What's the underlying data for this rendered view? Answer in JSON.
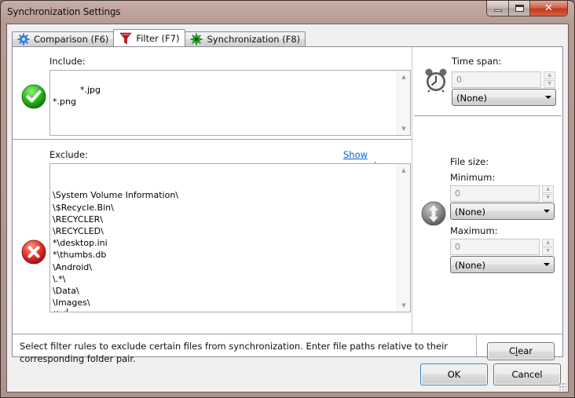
{
  "window": {
    "title": "Synchronization Settings",
    "controls": {
      "minimize": "minimize",
      "maximize": "maximize",
      "close": "close"
    }
  },
  "tabs": [
    {
      "label": "Comparison (F6)",
      "icon": "gear-blue-icon",
      "active": false
    },
    {
      "label": "Filter (F7)",
      "icon": "funnel-icon",
      "active": true
    },
    {
      "label": "Synchronization (F8)",
      "icon": "gear-green-icon",
      "active": false
    }
  ],
  "filter": {
    "include": {
      "label": "Include:",
      "icon": "checkmark-icon",
      "value": "*.jpg\n*.png"
    },
    "exclude": {
      "label": "Exclude:",
      "icon": "cross-icon",
      "show_examples_link": "Show examples",
      "lines": [
        "\\System Volume Information\\",
        "\\$Recycle.Bin\\",
        "\\RECYCLER\\",
        "\\RECYCLED\\",
        "*\\desktop.ini",
        "*\\thumbs.db",
        "\\Android\\",
        "\\.*\\",
        "\\Data\\",
        "\\Images\\",
        "*\\.*"
      ]
    },
    "time_span": {
      "label": "Time span:",
      "icon": "alarm-clock-icon",
      "value": "0",
      "unit_selected": "(None)"
    },
    "file_size": {
      "label": "File size:",
      "icon": "size-arrows-icon",
      "minimum": {
        "label": "Minimum:",
        "value": "0",
        "unit_selected": "(None)"
      },
      "maximum": {
        "label": "Maximum:",
        "value": "0",
        "unit_selected": "(None)"
      }
    },
    "description": "Select filter rules to exclude certain files from synchronization. Enter file paths relative to their corresponding folder pair.",
    "clear_button": {
      "pre": "C",
      "accel": "l",
      "post": "ear"
    }
  },
  "footer": {
    "ok_label": "OK",
    "cancel_label": "Cancel"
  }
}
